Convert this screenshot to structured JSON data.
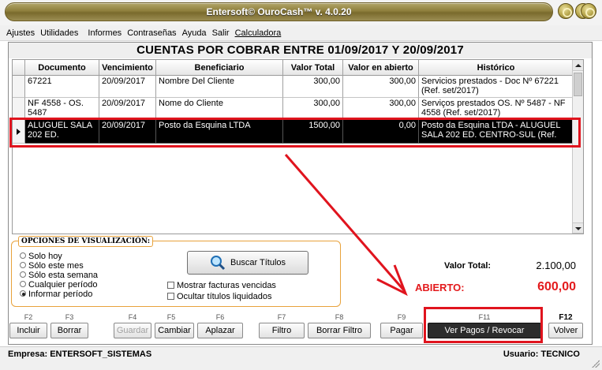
{
  "window": {
    "title": "Entersoft© OuroCash™ v. 4.0.20"
  },
  "menu": [
    "Ajustes",
    "Utilidades",
    "Informes",
    "Contraseñas",
    "Ayuda",
    "Salir",
    "Calculadora"
  ],
  "banner": "CUENTAS POR COBRAR ENTRE 01/09/2017 Y 20/09/2017",
  "grid": {
    "columns": [
      "Documento",
      "Vencimiento",
      "Beneficiario",
      "Valor Total",
      "Valor en abierto",
      "Histórico"
    ],
    "rows": [
      {
        "documento": "67221",
        "vencimiento": "20/09/2017",
        "beneficiario": "Nombre Del Cliente",
        "valor_total": "300,00",
        "valor_abierto": "300,00",
        "historico": "Servicios prestados - Doc Nº 67221 (Ref. set/2017)"
      },
      {
        "documento": "NF 4558 - OS. 5487",
        "vencimiento": "20/09/2017",
        "beneficiario": "Nome do Cliente",
        "valor_total": "300,00",
        "valor_abierto": "300,00",
        "historico": "Serviços prestados OS. Nº 5487 - NF 4558 (Ref. set/2017)"
      },
      {
        "documento": "ALUGUEL SALA 202 ED.",
        "vencimiento": "20/09/2017",
        "beneficiario": "Posto da Esquina LTDA",
        "valor_total": "1500,00",
        "valor_abierto": "0,00",
        "historico": "Posto da Esquina LTDA - ALUGUEL SALA 202 ED. CENTRO-SUL (Ref.",
        "selected": true
      }
    ]
  },
  "options": {
    "legend": "OPCIONES DE VISUALIZACIÓN:",
    "radios": [
      "Solo hoy",
      "Sólo este mes",
      "Sólo esta semana",
      "Cualquier período",
      "Informar período"
    ],
    "selected_radio": "Informar período",
    "buscar_label": "Buscar Títulos",
    "check_vencidas": "Mostrar facturas vencidas",
    "check_liquidados": "Ocultar títulos liquidados"
  },
  "totals": {
    "total_label": "Valor Total:",
    "total_value": "2.100,00",
    "abierto_label": "ABIERTO:",
    "abierto_value": "600,00"
  },
  "fkeys": [
    {
      "key": "F2",
      "label": "Incluir",
      "enabled": true
    },
    {
      "key": "F3",
      "label": "Borrar",
      "enabled": true
    },
    {
      "key": "F4",
      "label": "Guardar",
      "enabled": false
    },
    {
      "key": "F5",
      "label": "Cambiar",
      "enabled": true
    },
    {
      "key": "F6",
      "label": "Aplazar",
      "enabled": true
    },
    {
      "key": "F7",
      "label": "Filtro",
      "enabled": true
    },
    {
      "key": "F8",
      "label": "Borrar Filtro",
      "enabled": true
    },
    {
      "key": "F9",
      "label": "Pagar",
      "enabled": true
    },
    {
      "key": "F11",
      "label": "Ver Pagos / Revocar",
      "enabled": true
    },
    {
      "key": "F12",
      "label": "Volver",
      "enabled": true
    }
  ],
  "status": {
    "empresa": "Empresa: ENTERSOFT_SISTEMAS",
    "usuario": "Usuario: TECNICO"
  },
  "colors": {
    "accent_red": "#e31a1c",
    "title_gold": "#8e7f3c",
    "selected_row": "#000000"
  }
}
